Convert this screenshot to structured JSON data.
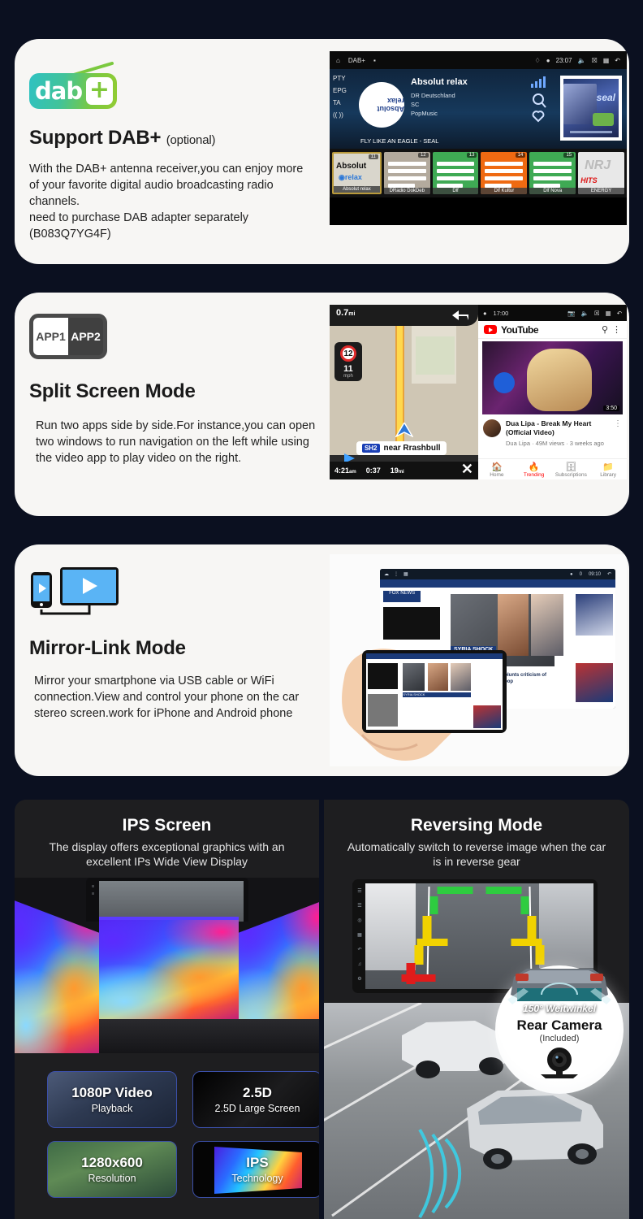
{
  "page": {
    "background": "#0b1020"
  },
  "features": [
    {
      "id": "dab",
      "icon": "dab-plus-logo",
      "logo_word": "dab",
      "logo_plus": "+",
      "title": "Support DAB+",
      "title_suffix": "(optional)",
      "body": "With the DAB+ antenna receiver,you can enjoy more of your favorite digital audio broadcasting radio channels.\nneed to purchase DAB adapter separately (B083Q7YG4F)"
    },
    {
      "id": "split",
      "icon": "split-screen-icon",
      "icon_left_label": "APP1",
      "icon_right_label": "APP2",
      "title": "Split Screen Mode",
      "title_suffix": "",
      "body": "Run two apps side by side.For instance,you can open two windows to run navigation on the left while using the video app to play video on the right."
    },
    {
      "id": "mirror",
      "icon": "mirror-link-icon",
      "title": "Mirror-Link Mode",
      "title_suffix": "",
      "body": "Mirror your smartphone via USB cable or WiFi connection.View and control your phone on the car stereo screen.work for iPhone and Android phone"
    }
  ],
  "dab_screen": {
    "status": {
      "app": "DAB+",
      "time": "23:07"
    },
    "side_labels": [
      "PTY",
      "EPG",
      "TA",
      "(( ))"
    ],
    "station": "Absolut relax",
    "disc_label": "Absolut relax",
    "meta": [
      "DR Deutschland",
      "SC",
      "PopMusic"
    ],
    "now_playing": "FLY LIKE AN EAGLE - SEAL",
    "album_art_label": "seal",
    "presets": [
      {
        "num": "11",
        "label": "Absolut relax",
        "color": "#d9d6cc",
        "style": "logo-absolut"
      },
      {
        "num": "12",
        "label": "DRadio DokDeb",
        "color": "#b3aa9d",
        "style": "bars"
      },
      {
        "num": "13",
        "label": "Dlf",
        "color": "#3faa54",
        "style": "bars"
      },
      {
        "num": "14",
        "label": "Dlf Kultur",
        "color": "#ef6a12",
        "style": "bars"
      },
      {
        "num": "15",
        "label": "Dlf Nova",
        "color": "#3faa54",
        "style": "bars"
      },
      {
        "num": "",
        "label": "ENERGY",
        "color": "#e8e8e8",
        "style": "logo-nrj"
      }
    ]
  },
  "split_screen": {
    "nav": {
      "distance": "0.7",
      "distance_unit": "mi",
      "speed_limit": "12",
      "speed": "11",
      "speed_unit": "mph",
      "street_badge": "SH2",
      "street": "near Rrashbull",
      "eta": "4:21",
      "eta_unit": "am",
      "remaining_time": "0:37",
      "remaining_dist": "19",
      "remaining_dist_unit": "mi",
      "close_label": "✕"
    },
    "youtube": {
      "status_time": "17:00",
      "brand": "YouTube",
      "video_duration": "3:50",
      "video_title": "Dua Lipa - Break My Heart (Official Video)",
      "video_meta": "Dua Lipa · 49M views · 3 weeks ago",
      "tabs": [
        "Home",
        "Trending",
        "Subscriptions",
        "Library"
      ],
      "active_tab": "Trending"
    }
  },
  "mirror_screen": {
    "status_time": "09:10",
    "status_count": "0",
    "headline": "SYRIA SHOCK",
    "subhead": "Al-Baghdadi takedown blunts criticism of Trump's pullout of the loop",
    "brand": "FOX NEWS"
  },
  "panels": {
    "ips": {
      "title": "IPS Screen",
      "subtitle": "The display offers exceptional graphics with an excellent IPs Wide View Display",
      "tiles": [
        {
          "t1": "1080P Video",
          "t2": "Playback",
          "bg": "photo-statue"
        },
        {
          "t1": "2.5D",
          "t2": "2.5D Large Screen",
          "bg": "dark-glass"
        },
        {
          "t1": "1280x600",
          "t2": "Resolution",
          "bg": "photo-lake"
        },
        {
          "t1": "IPS",
          "t2": "Technology",
          "bg": "ips-gradient"
        }
      ]
    },
    "reversing": {
      "title": "Reversing Mode",
      "subtitle": "Automatically switch to reverse image when the car is in reverse gear",
      "badge": {
        "angle": "150° Weitwinkel",
        "title": "Rear Camera",
        "subtitle": "(Included)"
      }
    }
  },
  "colors": {
    "page_bg": "#0b1020",
    "card_bg": "#f7f6f4",
    "panel_bg": "#1e1e20",
    "accent_green": "#7bc93f",
    "accent_teal": "#2fc2c2",
    "guide_green": "#2ecc40",
    "guide_yellow": "#f1d200",
    "guide_red": "#e01b1b"
  }
}
